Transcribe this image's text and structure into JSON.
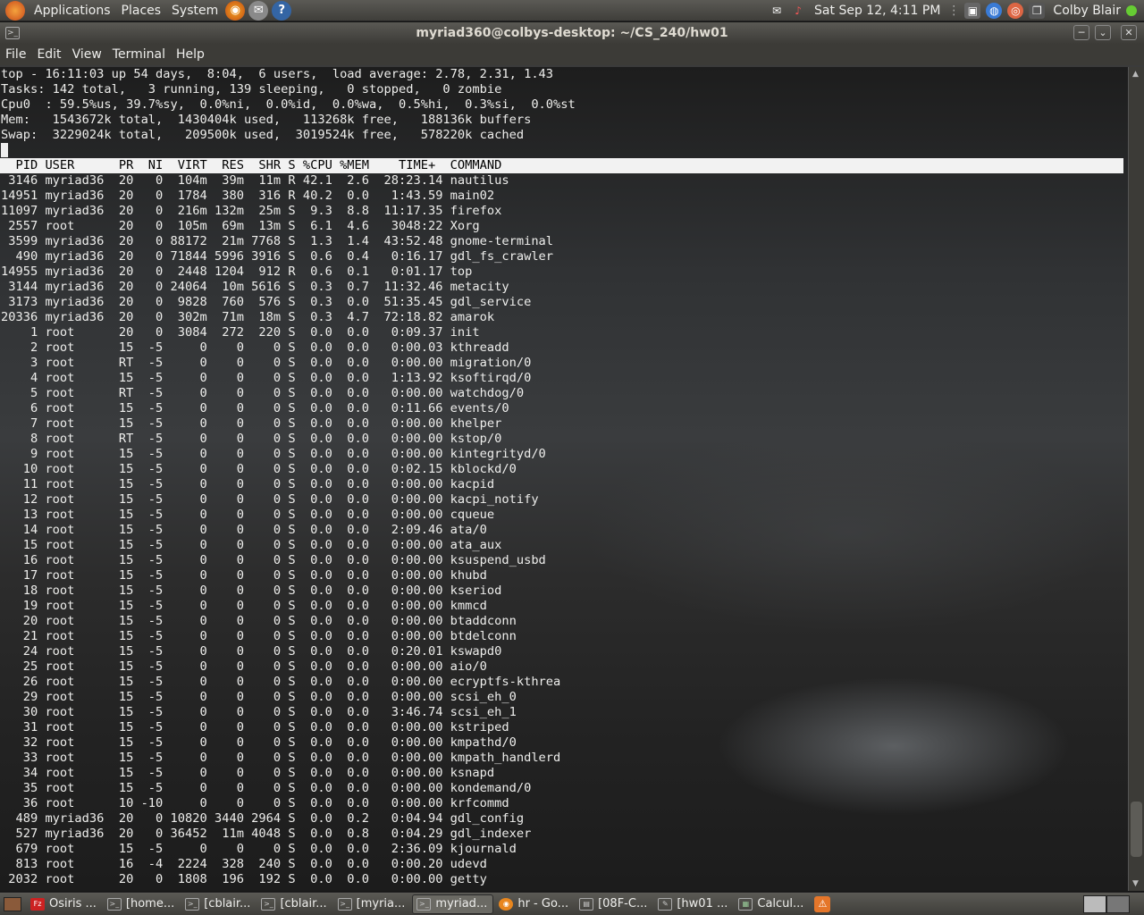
{
  "panel": {
    "menus": [
      "Applications",
      "Places",
      "System"
    ],
    "datetime": "Sat Sep 12,  4:11 PM",
    "user": "Colby Blair"
  },
  "window": {
    "title": "myriad360@colbys-desktop: ~/CS_240/hw01",
    "menus": [
      "File",
      "Edit",
      "View",
      "Terminal",
      "Help"
    ]
  },
  "terminal": {
    "summary": [
      "top - 16:11:03 up 54 days,  8:04,  6 users,  load average: 2.78, 2.31, 1.43",
      "Tasks: 142 total,   3 running, 139 sleeping,   0 stopped,   0 zombie",
      "Cpu0  : 59.5%us, 39.7%sy,  0.0%ni,  0.0%id,  0.0%wa,  0.5%hi,  0.3%si,  0.0%st",
      "Mem:   1543672k total,  1430404k used,   113268k free,   188136k buffers",
      "Swap:  3229024k total,   209500k used,  3019524k free,   578220k cached"
    ],
    "header": "  PID USER      PR  NI  VIRT  RES  SHR S %CPU %MEM    TIME+  COMMAND",
    "processes": [
      " 3146 myriad36  20   0  104m  39m  11m R 42.1  2.6  28:23.14 nautilus",
      "14951 myriad36  20   0  1784  380  316 R 40.2  0.0   1:43.59 main02",
      "11097 myriad36  20   0  216m 132m  25m S  9.3  8.8  11:17.35 firefox",
      " 2557 root      20   0  105m  69m  13m S  6.1  4.6   3048:22 Xorg",
      " 3599 myriad36  20   0 88172  21m 7768 S  1.3  1.4  43:52.48 gnome-terminal",
      "  490 myriad36  20   0 71844 5996 3916 S  0.6  0.4   0:16.17 gdl_fs_crawler",
      "14955 myriad36  20   0  2448 1204  912 R  0.6  0.1   0:01.17 top",
      " 3144 myriad36  20   0 24064  10m 5616 S  0.3  0.7  11:32.46 metacity",
      " 3173 myriad36  20   0  9828  760  576 S  0.3  0.0  51:35.45 gdl_service",
      "20336 myriad36  20   0  302m  71m  18m S  0.3  4.7  72:18.82 amarok",
      "    1 root      20   0  3084  272  220 S  0.0  0.0   0:09.37 init",
      "    2 root      15  -5     0    0    0 S  0.0  0.0   0:00.03 kthreadd",
      "    3 root      RT  -5     0    0    0 S  0.0  0.0   0:00.00 migration/0",
      "    4 root      15  -5     0    0    0 S  0.0  0.0   1:13.92 ksoftirqd/0",
      "    5 root      RT  -5     0    0    0 S  0.0  0.0   0:00.00 watchdog/0",
      "    6 root      15  -5     0    0    0 S  0.0  0.0   0:11.66 events/0",
      "    7 root      15  -5     0    0    0 S  0.0  0.0   0:00.00 khelper",
      "    8 root      RT  -5     0    0    0 S  0.0  0.0   0:00.00 kstop/0",
      "    9 root      15  -5     0    0    0 S  0.0  0.0   0:00.00 kintegrityd/0",
      "   10 root      15  -5     0    0    0 S  0.0  0.0   0:02.15 kblockd/0",
      "   11 root      15  -5     0    0    0 S  0.0  0.0   0:00.00 kacpid",
      "   12 root      15  -5     0    0    0 S  0.0  0.0   0:00.00 kacpi_notify",
      "   13 root      15  -5     0    0    0 S  0.0  0.0   0:00.00 cqueue",
      "   14 root      15  -5     0    0    0 S  0.0  0.0   2:09.46 ata/0",
      "   15 root      15  -5     0    0    0 S  0.0  0.0   0:00.00 ata_aux",
      "   16 root      15  -5     0    0    0 S  0.0  0.0   0:00.00 ksuspend_usbd",
      "   17 root      15  -5     0    0    0 S  0.0  0.0   0:00.00 khubd",
      "   18 root      15  -5     0    0    0 S  0.0  0.0   0:00.00 kseriod",
      "   19 root      15  -5     0    0    0 S  0.0  0.0   0:00.00 kmmcd",
      "   20 root      15  -5     0    0    0 S  0.0  0.0   0:00.00 btaddconn",
      "   21 root      15  -5     0    0    0 S  0.0  0.0   0:00.00 btdelconn",
      "   24 root      15  -5     0    0    0 S  0.0  0.0   0:20.01 kswapd0",
      "   25 root      15  -5     0    0    0 S  0.0  0.0   0:00.00 aio/0",
      "   26 root      15  -5     0    0    0 S  0.0  0.0   0:00.00 ecryptfs-kthrea",
      "   29 root      15  -5     0    0    0 S  0.0  0.0   0:00.00 scsi_eh_0",
      "   30 root      15  -5     0    0    0 S  0.0  0.0   3:46.74 scsi_eh_1",
      "   31 root      15  -5     0    0    0 S  0.0  0.0   0:00.00 kstriped",
      "   32 root      15  -5     0    0    0 S  0.0  0.0   0:00.00 kmpathd/0",
      "   33 root      15  -5     0    0    0 S  0.0  0.0   0:00.00 kmpath_handlerd",
      "   34 root      15  -5     0    0    0 S  0.0  0.0   0:00.00 ksnapd",
      "   35 root      15  -5     0    0    0 S  0.0  0.0   0:00.00 kondemand/0",
      "   36 root      10 -10     0    0    0 S  0.0  0.0   0:00.00 krfcommd",
      "  489 myriad36  20   0 10820 3440 2964 S  0.0  0.2   0:04.94 gdl_config",
      "  527 myriad36  20   0 36452  11m 4048 S  0.0  0.8   0:04.29 gdl_indexer",
      "  679 root      15  -5     0    0    0 S  0.0  0.0   2:36.09 kjournald",
      "  813 root      16  -4  2224  328  240 S  0.0  0.0   0:00.20 udevd",
      " 2032 root      20   0  1808  196  192 S  0.0  0.0   0:00.00 getty"
    ]
  },
  "taskbar": {
    "tasks": [
      {
        "label": "Osiris ...",
        "icon": "filezilla-icon",
        "active": false
      },
      {
        "label": "[home...",
        "icon": "terminal-icon",
        "active": false
      },
      {
        "label": "[cblair...",
        "icon": "terminal-icon",
        "active": false
      },
      {
        "label": "[cblair...",
        "icon": "terminal-icon",
        "active": false
      },
      {
        "label": "[myria...",
        "icon": "terminal-icon",
        "active": false
      },
      {
        "label": "myriad...",
        "icon": "terminal-icon",
        "active": true
      },
      {
        "label": "hr - Go...",
        "icon": "firefox-icon",
        "active": false
      },
      {
        "label": "[08F-C...",
        "icon": "document-icon",
        "active": false
      },
      {
        "label": "[hw01 ...",
        "icon": "editor-icon",
        "active": false
      },
      {
        "label": "Calcul...",
        "icon": "calculator-icon",
        "active": false
      }
    ]
  }
}
